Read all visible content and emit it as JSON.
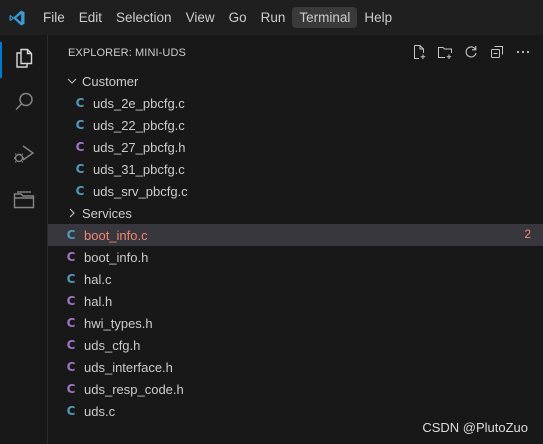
{
  "menu": {
    "items": [
      "File",
      "Edit",
      "Selection",
      "View",
      "Go",
      "Run",
      "Terminal",
      "Help"
    ],
    "active_index": 6
  },
  "activity_bar": [
    {
      "icon": "files-icon",
      "active": true
    },
    {
      "icon": "search-icon",
      "active": false
    },
    {
      "icon": "run-debug-icon",
      "active": false
    },
    {
      "icon": "folder-icon",
      "active": false
    }
  ],
  "explorer": {
    "title": "EXPLORER: MINI-UDS",
    "actions": [
      "new-file-icon",
      "new-folder-icon",
      "refresh-icon",
      "collapse-all-icon",
      "more-icon"
    ],
    "tree": [
      {
        "type": "folder",
        "label": "Customer",
        "expanded": true,
        "depth": 0
      },
      {
        "type": "file",
        "label": "uds_2e_pbcfg.c",
        "ext": "c",
        "depth": 1
      },
      {
        "type": "file",
        "label": "uds_22_pbcfg.c",
        "ext": "c",
        "depth": 1
      },
      {
        "type": "file",
        "label": "uds_27_pbcfg.h",
        "ext": "h",
        "depth": 1
      },
      {
        "type": "file",
        "label": "uds_31_pbcfg.c",
        "ext": "c",
        "depth": 1
      },
      {
        "type": "file",
        "label": "uds_srv_pbcfg.c",
        "ext": "c",
        "depth": 1
      },
      {
        "type": "folder",
        "label": "Services",
        "expanded": false,
        "depth": 0
      },
      {
        "type": "file",
        "label": "boot_info.c",
        "ext": "c",
        "depth": 0,
        "selected": true,
        "error": true,
        "badge": "2"
      },
      {
        "type": "file",
        "label": "boot_info.h",
        "ext": "h",
        "depth": 0
      },
      {
        "type": "file",
        "label": "hal.c",
        "ext": "c",
        "depth": 0
      },
      {
        "type": "file",
        "label": "hal.h",
        "ext": "h",
        "depth": 0
      },
      {
        "type": "file",
        "label": "hwi_types.h",
        "ext": "h",
        "depth": 0
      },
      {
        "type": "file",
        "label": "uds_cfg.h",
        "ext": "h",
        "depth": 0
      },
      {
        "type": "file",
        "label": "uds_interface.h",
        "ext": "h",
        "depth": 0
      },
      {
        "type": "file",
        "label": "uds_resp_code.h",
        "ext": "h",
        "depth": 0
      },
      {
        "type": "file",
        "label": "uds.c",
        "ext": "c",
        "depth": 0
      }
    ],
    "file_icon_letter": "C"
  },
  "colors": {
    "c_file": "#519aba",
    "h_file": "#a074c4",
    "error": "#f48771",
    "accent": "#0078d4"
  },
  "watermark": "CSDN @PlutoZuo"
}
